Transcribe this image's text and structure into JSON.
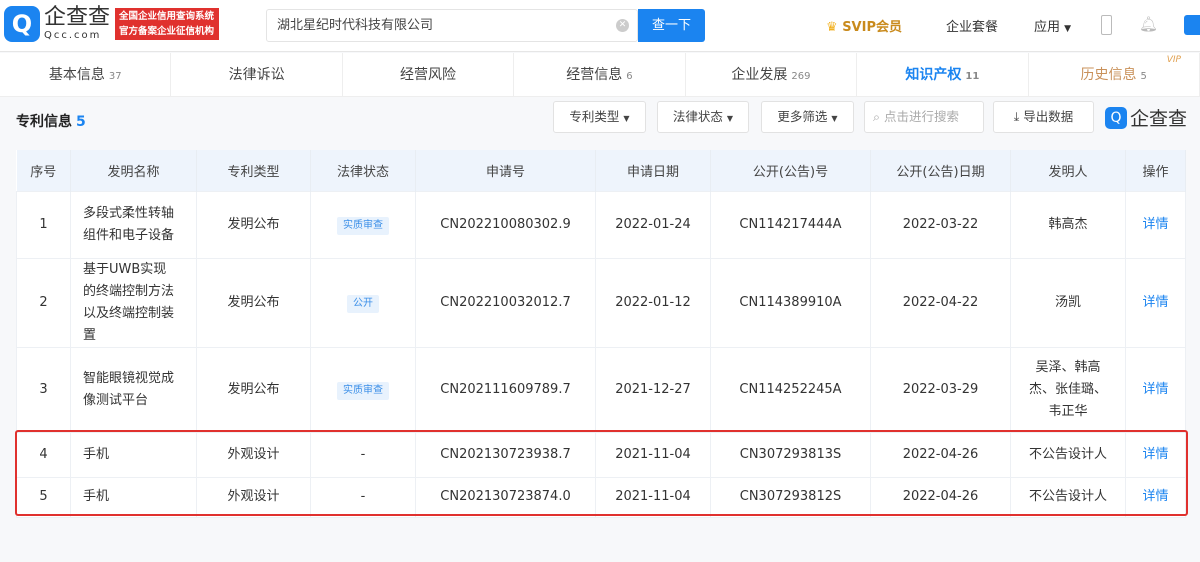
{
  "header": {
    "logo_cn": "企查查",
    "logo_en": "Qcc.com",
    "badge_line1": "全国企业信用查询系统",
    "badge_line2": "官方备案企业征信机构",
    "search_value": "湖北星纪时代科技有限公司",
    "search_button": "查一下",
    "svip": "SVIP会员",
    "enterprise_pkg": "企业套餐",
    "apps": "应用"
  },
  "tabs": [
    {
      "label": "基本信息",
      "count": "37"
    },
    {
      "label": "法律诉讼",
      "count": ""
    },
    {
      "label": "经营风险",
      "count": ""
    },
    {
      "label": "经营信息",
      "count": "6"
    },
    {
      "label": "企业发展",
      "count": "269"
    },
    {
      "label": "知识产权",
      "count": "11"
    },
    {
      "label": "历史信息",
      "count": "5",
      "badge": "VIP"
    }
  ],
  "section": {
    "title": "专利信息",
    "count": "5",
    "filters": [
      "专利类型",
      "法律状态",
      "更多筛选"
    ],
    "search_placeholder": "点击进行搜索",
    "export": "导出数据",
    "brand": "企查查"
  },
  "table": {
    "headers": [
      "序号",
      "发明名称",
      "专利类型",
      "法律状态",
      "申请号",
      "申请日期",
      "公开(公告)号",
      "公开(公告)日期",
      "发明人",
      "操作"
    ],
    "rows": [
      {
        "no": "1",
        "name": "多段式柔性转轴组件和电子设备",
        "type": "发明公布",
        "status": "实质审查",
        "app_no": "CN202210080302.9",
        "app_date": "2022-01-24",
        "pub_no": "CN114217444A",
        "pub_date": "2022-03-22",
        "inventor": "韩高杰",
        "action": "详情"
      },
      {
        "no": "2",
        "name": "基于UWB实现的终端控制方法以及终端控制装置",
        "type": "发明公布",
        "status": "公开",
        "app_no": "CN202210032012.7",
        "app_date": "2022-01-12",
        "pub_no": "CN114389910A",
        "pub_date": "2022-04-22",
        "inventor": "汤凯",
        "action": "详情"
      },
      {
        "no": "3",
        "name": "智能眼镜视觉成像测试平台",
        "type": "发明公布",
        "status": "实质审查",
        "app_no": "CN202111609789.7",
        "app_date": "2021-12-27",
        "pub_no": "CN114252245A",
        "pub_date": "2022-03-29",
        "inventor": "吴泽、韩高杰、张佳璐、韦正华",
        "action": "详情"
      },
      {
        "no": "4",
        "name": "手机",
        "type": "外观设计",
        "status": "-",
        "app_no": "CN202130723938.7",
        "app_date": "2021-11-04",
        "pub_no": "CN307293813S",
        "pub_date": "2022-04-26",
        "inventor": "不公告设计人",
        "action": "详情"
      },
      {
        "no": "5",
        "name": "手机",
        "type": "外观设计",
        "status": "-",
        "app_no": "CN202130723874.0",
        "app_date": "2021-11-04",
        "pub_no": "CN307293812S",
        "pub_date": "2022-04-26",
        "inventor": "不公告设计人",
        "action": "详情"
      }
    ]
  }
}
